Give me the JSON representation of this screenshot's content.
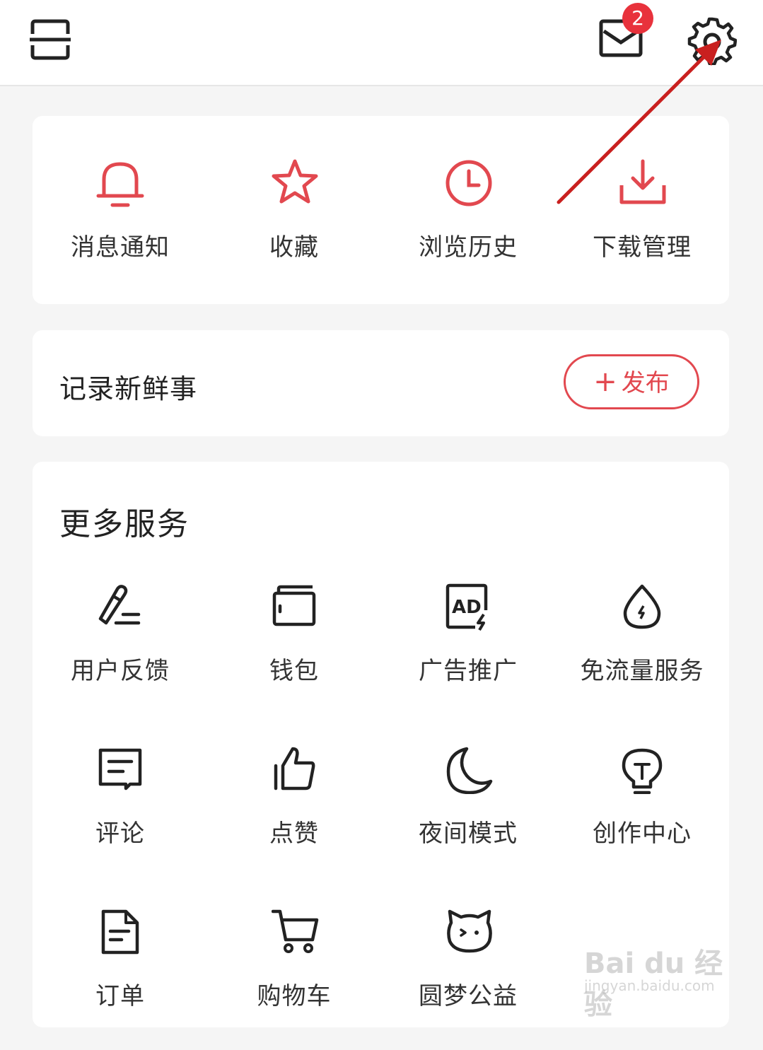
{
  "header": {
    "message_badge": "2",
    "icons": [
      "scan-icon",
      "mail-icon",
      "settings-icon"
    ]
  },
  "quick_actions": [
    {
      "label": "消息通知",
      "icon": "bell-icon"
    },
    {
      "label": "收藏",
      "icon": "star-icon"
    },
    {
      "label": "浏览历史",
      "icon": "clock-icon"
    },
    {
      "label": "下载管理",
      "icon": "download-icon"
    }
  ],
  "post": {
    "title": "记录新鲜事",
    "button_plus": "+",
    "button_label": "发布"
  },
  "services": {
    "title": "更多服务",
    "items": [
      {
        "label": "用户反馈",
        "icon": "pen-icon"
      },
      {
        "label": "钱包",
        "icon": "wallet-icon"
      },
      {
        "label": "广告推广",
        "icon": "ad-icon"
      },
      {
        "label": "免流量服务",
        "icon": "drop-icon"
      },
      {
        "label": "评论",
        "icon": "comment-icon"
      },
      {
        "label": "点赞",
        "icon": "thumbs-up-icon"
      },
      {
        "label": "夜间模式",
        "icon": "moon-icon"
      },
      {
        "label": "创作中心",
        "icon": "lightbulb-icon"
      },
      {
        "label": "订单",
        "icon": "document-icon"
      },
      {
        "label": "购物车",
        "icon": "cart-icon"
      },
      {
        "label": "圆梦公益",
        "icon": "cat-face-icon"
      }
    ],
    "ad_icon_text": "AD"
  },
  "watermark": {
    "main": "Bai du 经验",
    "sub": "jingyan.baidu.com"
  },
  "colors": {
    "accent": "#e2484f",
    "badge": "#e8323c",
    "annotation_arrow": "#c9201f"
  }
}
